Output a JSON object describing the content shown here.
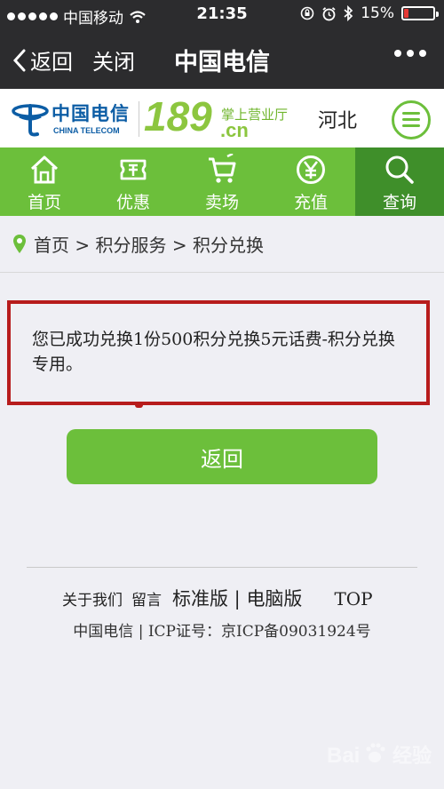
{
  "status_bar": {
    "carrier": "中国移动",
    "time": "21:35",
    "battery": "15%",
    "battery_level": 0.15
  },
  "nav_bar": {
    "back_label": "返回",
    "close_label": "关闭",
    "title": "中国电信"
  },
  "header": {
    "logo_cn": "中国电信",
    "logo_en": "CHINA TELECOM",
    "logo_number": "189",
    "logo_tagline": "掌上营业厅",
    "logo_domain": ".cn",
    "region": "河北"
  },
  "main_nav": {
    "items": [
      {
        "label": "首页",
        "icon": "home-icon"
      },
      {
        "label": "优惠",
        "icon": "discount-icon"
      },
      {
        "label": "卖场",
        "icon": "cart-icon"
      },
      {
        "label": "充值",
        "icon": "yen-icon"
      },
      {
        "label": "查询",
        "icon": "search-icon"
      }
    ],
    "active_index": 4
  },
  "breadcrumb": {
    "text": "首页 > 积分服务 > 积分兑换"
  },
  "message": {
    "text": "您已成功兑换1份500积分兑换5元话费-积分兑换专用。"
  },
  "actions": {
    "back_button_label": "返回"
  },
  "footer": {
    "about": "关于我们",
    "feedback": "留言",
    "standard": "标准版",
    "separator": " | ",
    "desktop": "电脑版",
    "top": "TOP",
    "info": "中国电信 | ICP证号：京ICP备09031924号"
  },
  "watermark": {
    "text": "经验"
  },
  "colors": {
    "brand_green": "#6cbf3b",
    "active_green": "#3f8f2a",
    "bar_dark": "#2c2c2e",
    "highlight_red": "#b71c1c",
    "telecom_blue": "#0c5da5"
  }
}
